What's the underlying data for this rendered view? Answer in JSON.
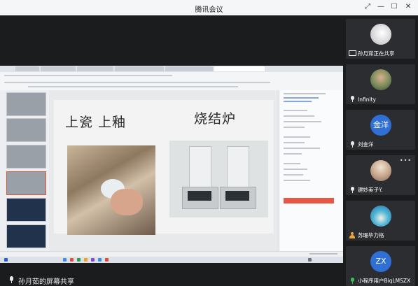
{
  "window": {
    "title": "腾讯会议",
    "icons": [
      "restore-icon",
      "minimize-icon",
      "maximize-icon",
      "close-icon"
    ]
  },
  "shared_screen": {
    "slide": {
      "heading_left": "上瓷 上釉",
      "heading_right": "烧结炉"
    }
  },
  "share_status": {
    "label": "孙月茹的屏幕共享"
  },
  "participants": [
    {
      "name": "孙月茹正在共享",
      "status_icon": "screen-share-icon",
      "avatar_type": "photo"
    },
    {
      "name": "Infinity",
      "status_icon": "mic-muted-icon",
      "avatar_type": "photo"
    },
    {
      "name": "刘金洋",
      "status_icon": "mic-muted-icon",
      "avatar_type": "initials",
      "initials": "金洋",
      "color": "#2f6fd6"
    },
    {
      "name": "建妙美子Y.",
      "status_icon": "mic-muted-icon",
      "avatar_type": "photo"
    },
    {
      "name": "苏珊毕力格",
      "status_icon": "person-icon",
      "avatar_type": "photo"
    },
    {
      "name": "小程序用户BiqLMSZX",
      "status_icon": "mic-active-icon",
      "avatar_type": "initials",
      "initials": "ZX",
      "color": "#2f6fd6"
    }
  ]
}
